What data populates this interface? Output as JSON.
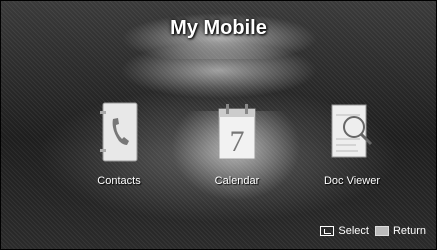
{
  "header": {
    "title": "My Mobile"
  },
  "apps": [
    {
      "label": "Contacts",
      "icon": "contacts-icon"
    },
    {
      "label": "Calendar",
      "icon": "calendar-icon",
      "day": "7"
    },
    {
      "label": "Doc Viewer",
      "icon": "doc-viewer-icon"
    }
  ],
  "footer": {
    "select_label": "Select",
    "return_label": "Return"
  }
}
